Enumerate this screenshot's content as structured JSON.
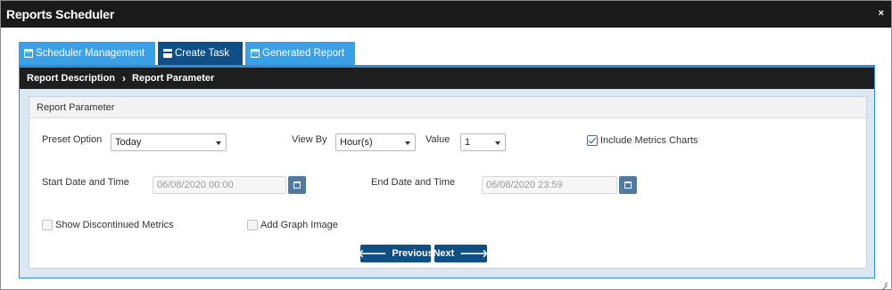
{
  "window": {
    "title": "Reports Scheduler",
    "close_icon": "×"
  },
  "tabs": [
    {
      "label": "Scheduler Management",
      "icon": "calendar-icon",
      "active": false
    },
    {
      "label": "Create Task",
      "icon": "card-icon",
      "active": true
    },
    {
      "label": "Generated Report",
      "icon": "calendar-icon",
      "active": false
    }
  ],
  "breadcrumb": {
    "items": [
      "Report Description",
      "Report Parameter"
    ],
    "separator": "›"
  },
  "section": {
    "title": "Report Parameter"
  },
  "form": {
    "preset": {
      "label": "Preset Option",
      "value": "Today"
    },
    "view_by": {
      "label": "View By",
      "value": "Hour(s)"
    },
    "value": {
      "label": "Value",
      "value": "1"
    },
    "include_metrics": {
      "label": "Include Metrics Charts",
      "checked": true
    },
    "start": {
      "label": "Start Date and Time",
      "value": "06/08/2020 00:00"
    },
    "end": {
      "label": "End Date and Time",
      "value": "06/08/2020 23:59"
    },
    "show_discontinued": {
      "label": "Show Discontinued Metrics",
      "checked": false
    },
    "add_graph": {
      "label": "Add Graph Image",
      "checked": false
    }
  },
  "buttons": {
    "previous": "Previous",
    "next": "Next"
  },
  "colors": {
    "titlebar": "#1a1a1a",
    "tab_light": "#3aa0e8",
    "tab_dark": "#0d4f86",
    "button": "#0d4f86"
  }
}
